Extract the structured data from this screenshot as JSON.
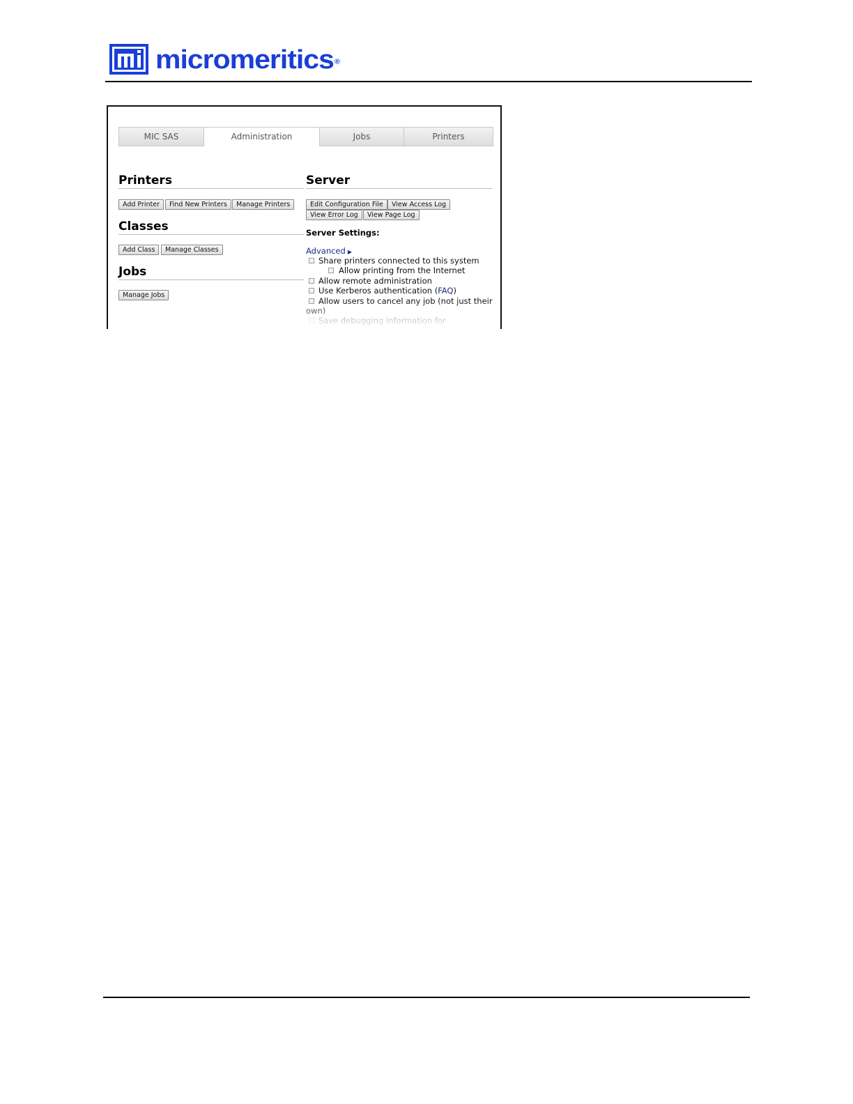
{
  "logo": {
    "brand": "micromeritics",
    "registered": "®"
  },
  "tabs": [
    {
      "label": "MIC SAS"
    },
    {
      "label": "Administration",
      "active": true
    },
    {
      "label": "Jobs"
    },
    {
      "label": "Printers"
    }
  ],
  "printers": {
    "title": "Printers",
    "buttons": [
      "Add Printer",
      "Find New Printers",
      "Manage Printers"
    ]
  },
  "classes": {
    "title": "Classes",
    "buttons": [
      "Add Class",
      "Manage Classes"
    ]
  },
  "jobs": {
    "title": "Jobs",
    "buttons": [
      "Manage Jobs"
    ]
  },
  "server": {
    "title": "Server",
    "buttons": [
      "Edit Configuration File",
      "View Access Log",
      "View Error Log",
      "View Page Log"
    ],
    "settings_label": "Server Settings:",
    "advanced_label": "Advanced",
    "options": {
      "share": "Share printers connected to this system",
      "internet": "Allow printing from the Internet",
      "remote_admin": "Allow remote administration",
      "kerberos_pre": "Use Kerberos authentication (",
      "kerberos_link": "FAQ",
      "kerberos_post": ")",
      "cancel_line1": "Allow users to cancel any job (not just their",
      "cancel_line2": "own)",
      "debug": "Save debugging information for"
    }
  },
  "colors": {
    "brand_blue": "#1a3fd6",
    "link_blue": "#1f2a8a"
  }
}
